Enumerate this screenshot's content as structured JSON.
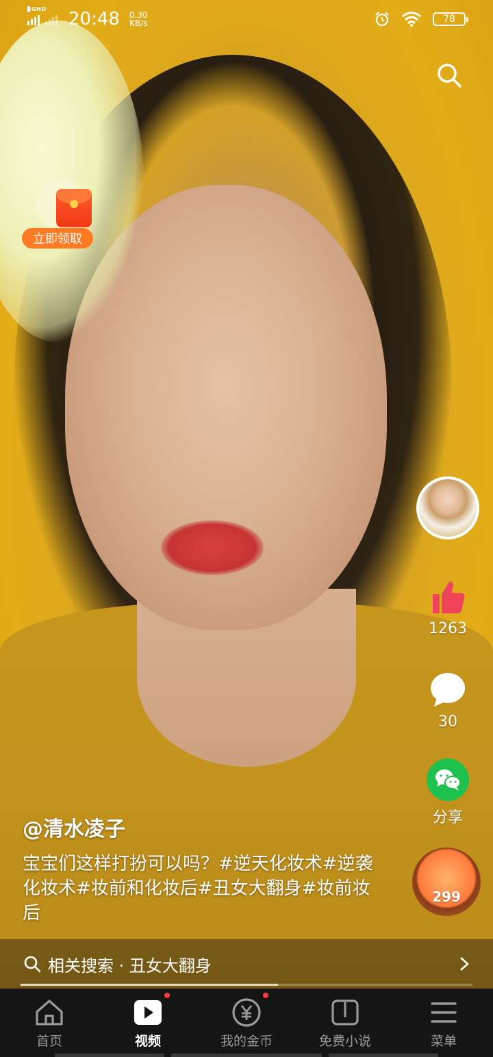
{
  "status_bar": {
    "network": "4GHD",
    "time": "20:48",
    "speed_value": "0.30",
    "speed_unit": "KB/s",
    "battery": "78"
  },
  "icons": {
    "search": "search-icon",
    "alarm": "alarm-icon",
    "wifi": "wifi-icon",
    "like": "thumbs-up-icon",
    "comment": "comment-bubble-icon",
    "share": "wechat-icon",
    "home": "home-icon",
    "video": "play-icon",
    "coins": "yuan-coin-icon",
    "novel": "book-icon",
    "menu": "hamburger-menu-icon"
  },
  "red_packet": {
    "label": "立即领取"
  },
  "actions": {
    "like_count": "1263",
    "comment_count": "30",
    "share_label": "分享",
    "coin_count": "299"
  },
  "post": {
    "author": "@清水凌子",
    "description": "宝宝们这样打扮可以吗？#逆天化妆术#逆袭化妆术#妆前和化妆后#丑女大翻身#妆前妆后"
  },
  "related_search": {
    "label": "相关搜索 · 丑女大翻身"
  },
  "playback": {
    "progress": 0.57
  },
  "bottom_nav": {
    "items": [
      {
        "label": "首页",
        "active": false,
        "dot": false
      },
      {
        "label": "视频",
        "active": true,
        "dot": true
      },
      {
        "label": "我的金币",
        "active": false,
        "dot": true
      },
      {
        "label": "免费小说",
        "active": false,
        "dot": false
      },
      {
        "label": "菜单",
        "active": false,
        "dot": false
      }
    ]
  },
  "colors": {
    "nav_bg": "#151515",
    "red_dot": "#ff3b3b",
    "like_red": "#f0445a",
    "wechat_green": "#1fc14e",
    "red_packet_label": "#ff7a22"
  }
}
